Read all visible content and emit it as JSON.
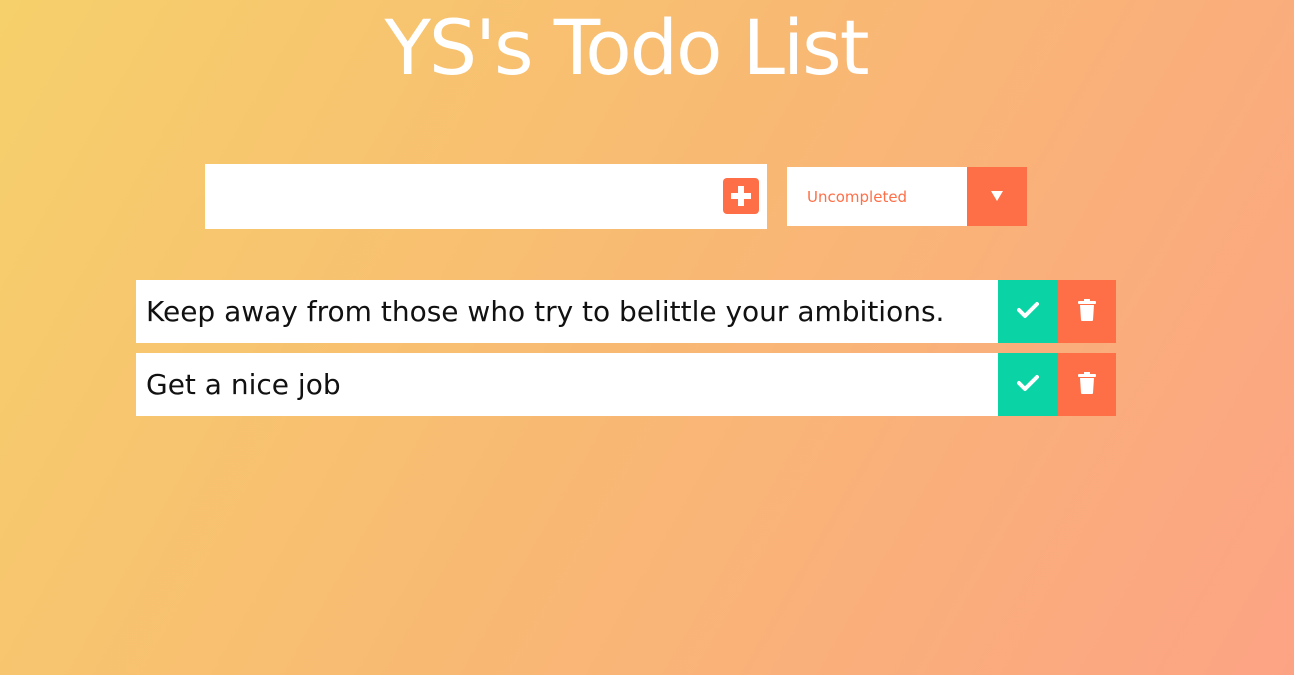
{
  "header": {
    "title": "YS's Todo List"
  },
  "input": {
    "value": "",
    "placeholder": ""
  },
  "filter": {
    "selected": "Uncompleted"
  },
  "todos": [
    {
      "text": "Keep away from those who try to belittle your ambitions."
    },
    {
      "text": "Get a nice job"
    }
  ],
  "icons": {
    "add": "plus-square-icon",
    "dropdown": "caret-down-icon",
    "complete": "check-icon",
    "delete": "trash-icon"
  },
  "colors": {
    "accent": "#ff6f47",
    "complete": "#0ad3a6",
    "title": "#ffffff"
  }
}
